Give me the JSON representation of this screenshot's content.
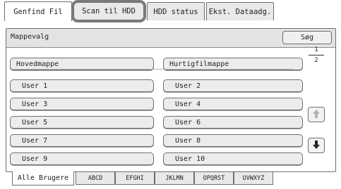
{
  "top_tabs": [
    {
      "label": "Genfind Fil"
    },
    {
      "label": "Scan til HDD"
    },
    {
      "label": "HDD status"
    },
    {
      "label": "Ekst. Dataadg."
    }
  ],
  "header": {
    "folder_select_label": "Mappevalg",
    "search_label": "Søg"
  },
  "folders": {
    "main": "Hovedmappe",
    "quick": "Hurtigfilmappe"
  },
  "users": [
    "User 1",
    "User 2",
    "User 3",
    "User 4",
    "User 5",
    "User 6",
    "User 7",
    "User 8",
    "User 9",
    "User 10"
  ],
  "pagination": {
    "current": "1",
    "total": "2"
  },
  "icons": {
    "up": "arrow-up-icon",
    "down": "arrow-down-icon"
  },
  "bottom_tabs": [
    {
      "label": "Alle Brugere"
    },
    {
      "label": "ABCD"
    },
    {
      "label": "EFGHI"
    },
    {
      "label": "JKLMN"
    },
    {
      "label": "OPQRST"
    },
    {
      "label": "UVWXYZ"
    }
  ]
}
